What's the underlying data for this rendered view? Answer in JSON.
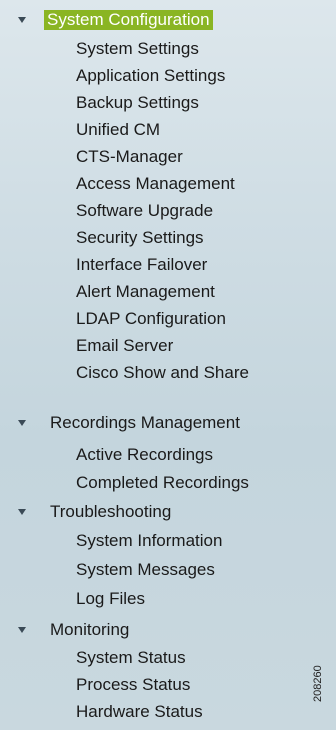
{
  "sections": [
    {
      "label": "System Configuration",
      "selected": true,
      "items": [
        "System Settings",
        "Application Settings",
        "Backup Settings",
        "Unified CM",
        "CTS-Manager",
        "Access Management",
        "Software Upgrade",
        "Security Settings",
        "Interface Failover",
        "Alert Management",
        "LDAP Configuration",
        "Email Server",
        "Cisco Show and Share"
      ]
    },
    {
      "label": "Recordings Management",
      "selected": false,
      "items": [
        "Active Recordings",
        "Completed Recordings"
      ]
    },
    {
      "label": "Troubleshooting",
      "selected": false,
      "items": [
        "System Information",
        "System Messages",
        "Log Files"
      ]
    },
    {
      "label": "Monitoring",
      "selected": false,
      "items": [
        "System Status",
        "Process Status",
        "Hardware Status"
      ]
    }
  ],
  "figure_id": "208260"
}
